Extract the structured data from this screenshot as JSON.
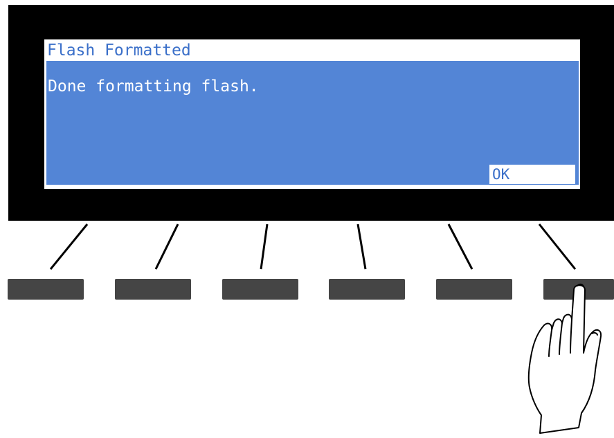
{
  "dialog": {
    "title": "Flash Formatted",
    "message": "Done formatting flash.",
    "ok_label": "OK"
  },
  "soft_buttons": [
    {
      "name": "soft-button-1"
    },
    {
      "name": "soft-button-2"
    },
    {
      "name": "soft-button-3"
    },
    {
      "name": "soft-button-4"
    },
    {
      "name": "soft-button-5"
    },
    {
      "name": "soft-button-6"
    }
  ],
  "colors": {
    "bezel": "#000000",
    "screen_background": "#ffffff",
    "dialog_body": "#5385d6",
    "title_text": "#3a6fc9",
    "message_text": "#ffffff",
    "soft_button": "#454545"
  },
  "icons": {
    "pressing_hand": "pointing-hand-icon"
  }
}
